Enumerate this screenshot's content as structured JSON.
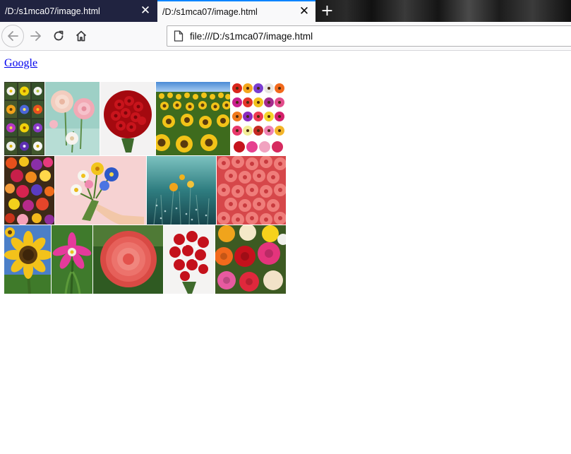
{
  "browser": {
    "tabs": [
      {
        "title": "/D:/s1mca07/image.html",
        "active": false
      },
      {
        "title": "/D:/s1mca07/image.html",
        "active": true
      }
    ],
    "close_glyph": "✕",
    "new_tab_glyph": "+",
    "url": "file:///D:/s1mca07/image.html",
    "accent_color": "#0a84ff",
    "tab_strip_color": "#202340"
  },
  "page": {
    "link_text": "Google",
    "gallery": {
      "row1": [
        "flower-grid-photo",
        "pink-dahlias-photo",
        "red-rose-bouquet-photo",
        "sunflower-field-photo",
        "gerbera-collage-photo"
      ],
      "row2": [
        "mixed-flower-bed-photo",
        "hand-holding-bouquet-photo",
        "teal-field-flowers-photo",
        "pink-roses-closeup-photo"
      ],
      "row3": [
        "sunflower-closeup-photo",
        "pink-lily-photo",
        "coral-dahlia-photo",
        "red-rose-bouquet-2-photo",
        "colorful-roses-photo"
      ]
    }
  }
}
